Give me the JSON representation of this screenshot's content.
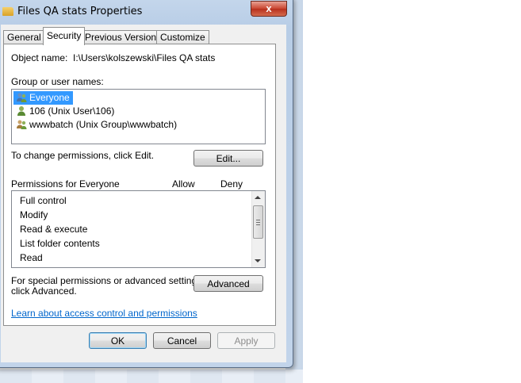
{
  "window": {
    "title": "Files QA stats Properties",
    "close_glyph": "x"
  },
  "tabs": [
    {
      "label": "General",
      "active": false
    },
    {
      "label": "Security",
      "active": true
    },
    {
      "label": "Previous Versions",
      "active": false
    },
    {
      "label": "Customize",
      "active": false
    }
  ],
  "security": {
    "object_name_label": "Object name:",
    "object_name_value": "I:\\Users\\kolszewski\\Files QA stats",
    "group_label": "Group or user names:",
    "users": [
      {
        "name": "Everyone",
        "icon": "group-icon",
        "selected": true
      },
      {
        "name": "106 (Unix User\\106)",
        "icon": "user-icon",
        "selected": false
      },
      {
        "name": "wwwbatch (Unix Group\\wwwbatch)",
        "icon": "group-icon",
        "selected": false
      }
    ],
    "change_text": "To change permissions, click Edit.",
    "edit_label": "Edit...",
    "permissions_header": "Permissions for Everyone",
    "allow_header": "Allow",
    "deny_header": "Deny",
    "permissions": [
      "Full control",
      "Modify",
      "Read & execute",
      "List folder contents",
      "Read"
    ],
    "special_text_1": "For special permissions or advanced settings,",
    "special_text_2": "click Advanced.",
    "advanced_label": "Advanced",
    "learn_link": "Learn about access control and permissions"
  },
  "buttons": {
    "ok": "OK",
    "cancel": "Cancel",
    "apply": "Apply"
  },
  "colors": {
    "selection": "#3399ff",
    "link": "#0066cc"
  }
}
